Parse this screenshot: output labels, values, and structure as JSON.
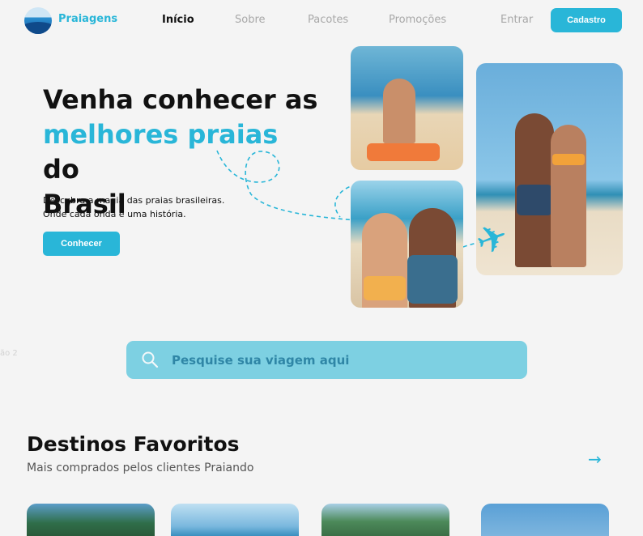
{
  "brand": {
    "name": "Praiagens"
  },
  "nav": {
    "links": [
      "Início",
      "Sobre",
      "Pacotes",
      "Promoções",
      "Entrar"
    ],
    "signup_label": "Cadastro"
  },
  "hero": {
    "title_part1": "Venha conhecer as",
    "title_highlight": "melhores praias",
    "title_part2": " do",
    "title_part3": "Brasil",
    "subtitle_line1": "Descubra a magia das praias brasileiras.",
    "subtitle_line2": "Onde cada onda é uma história.",
    "cta_label": "Conhecer"
  },
  "side_label": "ão 2",
  "search": {
    "placeholder": "Pesquise sua viagem aqui"
  },
  "destinations": {
    "title": "Destinos Favoritos",
    "subtitle": "Mais comprados pelos clientes Praiando",
    "arrow": "→"
  },
  "colors": {
    "accent": "#29b6d8",
    "search_bg": "#7dd0e2",
    "background": "#f4f4f4"
  }
}
